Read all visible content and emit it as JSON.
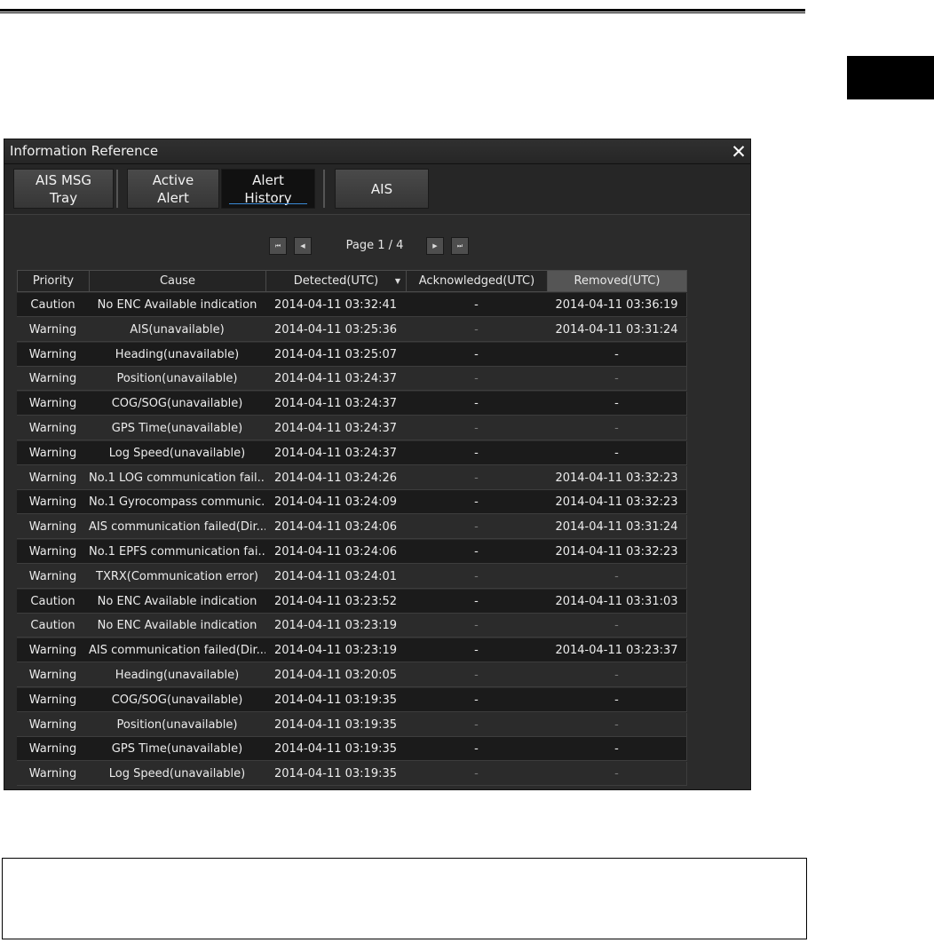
{
  "window": {
    "title": "Information Reference",
    "close_label": "✕"
  },
  "toolbar": {
    "buttons": [
      {
        "line1": "AIS MSG",
        "line2": "Tray"
      },
      {
        "line1": "Active",
        "line2": "Alert"
      },
      {
        "line1": "Alert",
        "line2": "History"
      },
      {
        "line1": "AIS",
        "line2": ""
      }
    ],
    "selected": "Alert History"
  },
  "pager": {
    "label": "Page 1 / 4",
    "first": "⏮",
    "prev": "◀",
    "next": "▶",
    "last": "⏭"
  },
  "table": {
    "columns": [
      "Priority",
      "Cause",
      "Detected(UTC)",
      "Acknowledged(UTC)",
      "Removed(UTC)"
    ],
    "sort_indicator": "▼",
    "rows": [
      [
        "Caution",
        "No ENC Available indication",
        "2014-04-11 03:32:41",
        "-",
        "2014-04-11 03:36:19"
      ],
      [
        "Warning",
        "AIS(unavailable)",
        "2014-04-11 03:25:36",
        "-",
        "2014-04-11 03:31:24"
      ],
      [
        "Warning",
        "Heading(unavailable)",
        "2014-04-11 03:25:07",
        "-",
        "-"
      ],
      [
        "Warning",
        "Position(unavailable)",
        "2014-04-11 03:24:37",
        "-",
        "-"
      ],
      [
        "Warning",
        "COG/SOG(unavailable)",
        "2014-04-11 03:24:37",
        "-",
        "-"
      ],
      [
        "Warning",
        "GPS Time(unavailable)",
        "2014-04-11 03:24:37",
        "-",
        "-"
      ],
      [
        "Warning",
        "Log Speed(unavailable)",
        "2014-04-11 03:24:37",
        "-",
        "-"
      ],
      [
        "Warning",
        "No.1 LOG communication fail...",
        "2014-04-11 03:24:26",
        "-",
        "2014-04-11 03:32:23"
      ],
      [
        "Warning",
        "No.1 Gyrocompass communic...",
        "2014-04-11 03:24:09",
        "-",
        "2014-04-11 03:32:23"
      ],
      [
        "Warning",
        "AIS communication failed(Dir...",
        "2014-04-11 03:24:06",
        "-",
        "2014-04-11 03:31:24"
      ],
      [
        "Warning",
        "No.1 EPFS communication fai...",
        "2014-04-11 03:24:06",
        "-",
        "2014-04-11 03:32:23"
      ],
      [
        "Warning",
        "TXRX(Communication error)",
        "2014-04-11 03:24:01",
        "-",
        "-"
      ],
      [
        "Caution",
        "No ENC Available indication",
        "2014-04-11 03:23:52",
        "-",
        "2014-04-11 03:31:03"
      ],
      [
        "Caution",
        "No ENC Available indication",
        "2014-04-11 03:23:19",
        "-",
        "-"
      ],
      [
        "Warning",
        "AIS communication failed(Dir...",
        "2014-04-11 03:23:19",
        "-",
        "2014-04-11 03:23:37"
      ],
      [
        "Warning",
        "Heading(unavailable)",
        "2014-04-11 03:20:05",
        "-",
        "-"
      ],
      [
        "Warning",
        "COG/SOG(unavailable)",
        "2014-04-11 03:19:35",
        "-",
        "-"
      ],
      [
        "Warning",
        "Position(unavailable)",
        "2014-04-11 03:19:35",
        "-",
        "-"
      ],
      [
        "Warning",
        "GPS Time(unavailable)",
        "2014-04-11 03:19:35",
        "-",
        "-"
      ],
      [
        "Warning",
        "Log Speed(unavailable)",
        "2014-04-11 03:19:35",
        "-",
        "-"
      ]
    ]
  }
}
